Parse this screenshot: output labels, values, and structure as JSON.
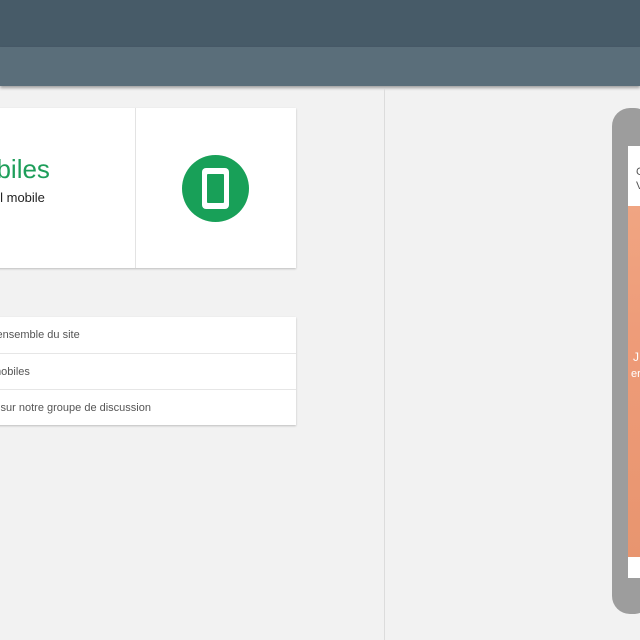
{
  "result": {
    "title": "obiles",
    "subtitle": "eil mobile",
    "icon": "smartphone-icon",
    "accent_color": "#18a058"
  },
  "links": [
    {
      "label": "l'ensemble du site"
    },
    {
      "label": "mobiles"
    },
    {
      "label": "s sur notre groupe de discussion"
    }
  ],
  "preview": {
    "header_line1": "C",
    "header_line2": "V",
    "hero_line1": "J",
    "hero_line2": "er",
    "hero_color": "#f0a582"
  }
}
